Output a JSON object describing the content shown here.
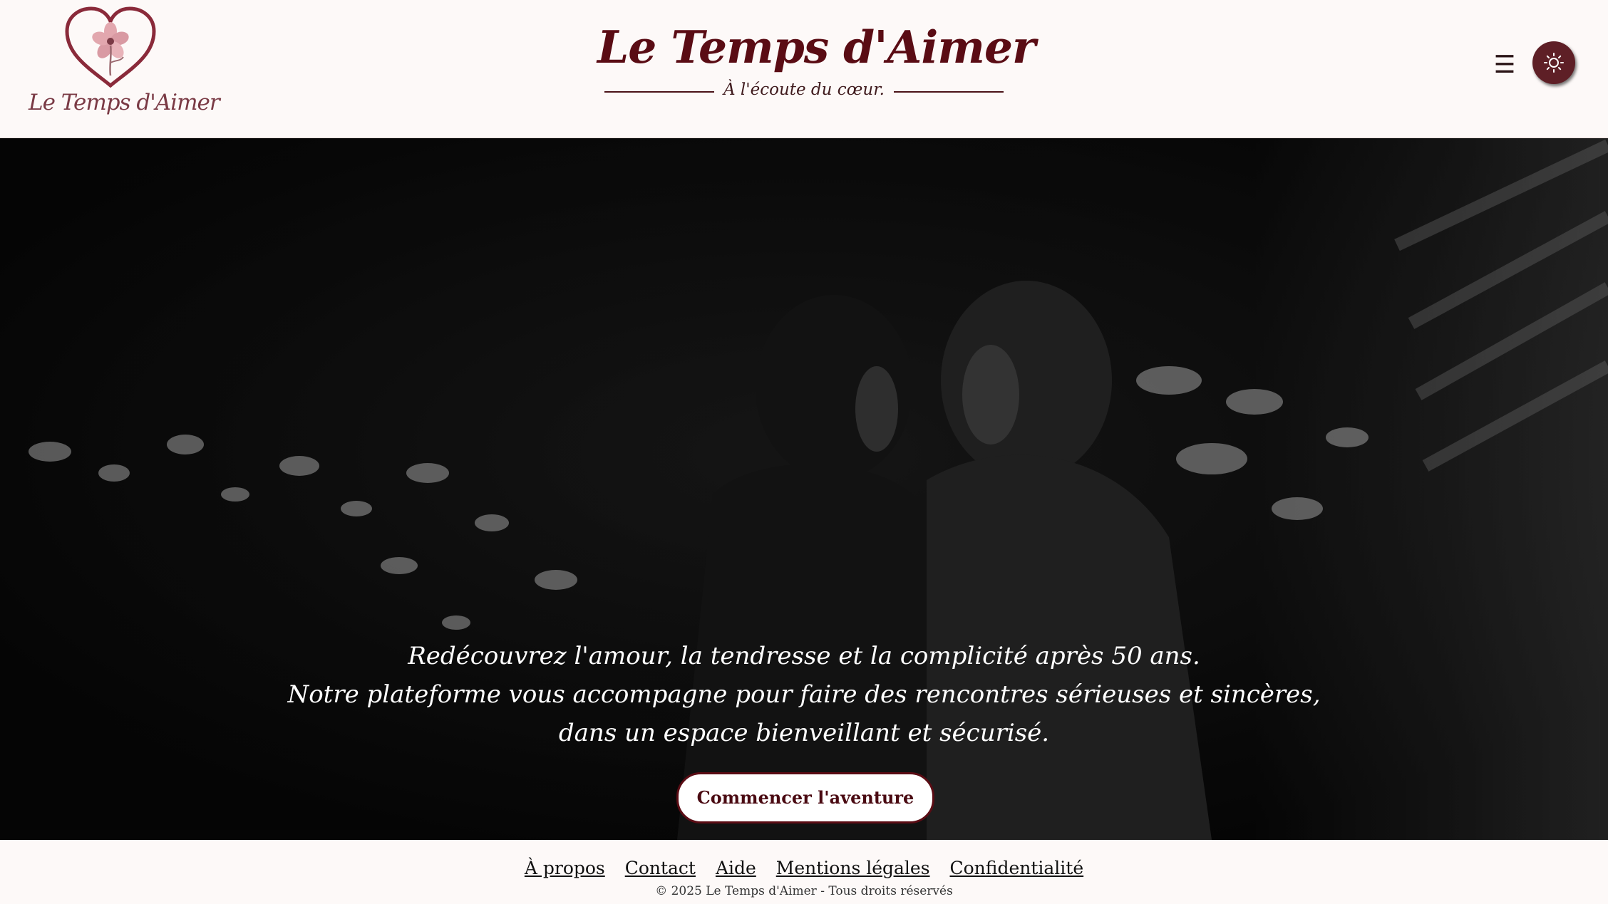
{
  "logo": {
    "icon": "heart-flower-icon",
    "text": "Le Temps d'Aimer"
  },
  "brand": {
    "title": "Le Temps d'Aimer",
    "tagline": "À l'écoute du cœur."
  },
  "header": {
    "menu_icon": "☰",
    "theme_icon": "sun-icon"
  },
  "hero": {
    "image": "black-and-white-couple-photo",
    "lines": [
      "Redécouvrez l'amour, la tendresse et la complicité après 50 ans.",
      "Notre plateforme vous accompagne pour faire des rencontres sérieuses et sincères,",
      "dans un espace bienveillant et sécurisé."
    ],
    "cta_label": "Commencer l'aventure"
  },
  "footer": {
    "links": [
      "À propos",
      "Contact",
      "Aide",
      "Mentions légales",
      "Confidentialité"
    ],
    "copyright": "© 2025 Le Temps d'Aimer - Tous droits réservés"
  },
  "colors": {
    "brand": "#5a0c14",
    "background": "#fdf9f8",
    "theme_button": "#5e1f26",
    "logo_pink": "#d99aa3"
  }
}
